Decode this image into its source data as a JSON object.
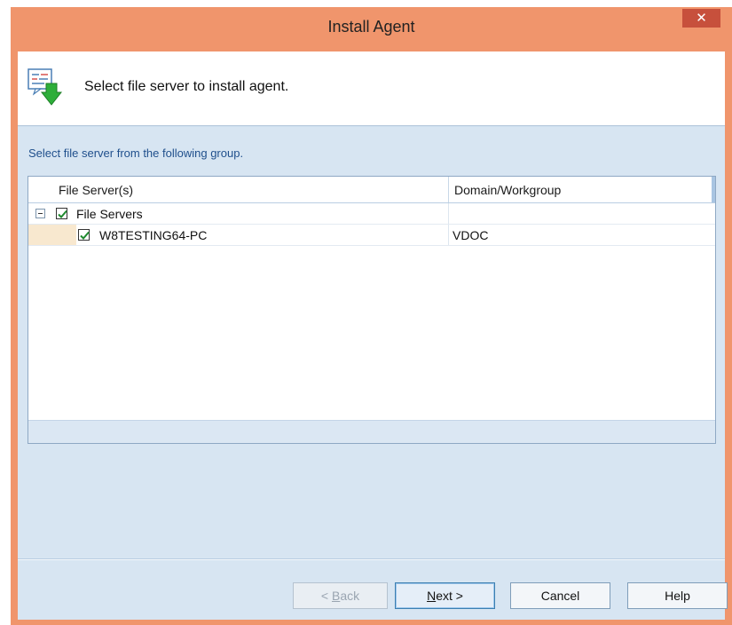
{
  "window": {
    "title": "Install Agent",
    "close_label": "✕"
  },
  "header": {
    "icon": "install-agent-icon",
    "text": "Select file server to install agent."
  },
  "body": {
    "instruction": "Select file server from the following group."
  },
  "tree": {
    "columns": [
      "File Server(s)",
      "Domain/Workgroup"
    ],
    "rows": [
      {
        "label": "File Servers",
        "domain": "",
        "checked": true,
        "expanded": true
      },
      {
        "label": "W8TESTING64-PC",
        "domain": "VDOC",
        "checked": true
      }
    ]
  },
  "buttons": {
    "back": {
      "prefix": "< ",
      "mnemonic": "B",
      "rest": "ack",
      "enabled": false
    },
    "next": {
      "mnemonic": "N",
      "rest": "ext >",
      "enabled": true
    },
    "cancel": "Cancel",
    "help": "Help"
  },
  "colors": {
    "title_bar": "#f0956c",
    "close_button": "#c7503c",
    "panel": "#d7e5f2",
    "instruction_text": "#1f4f8c",
    "check": "#1e8a2e"
  }
}
